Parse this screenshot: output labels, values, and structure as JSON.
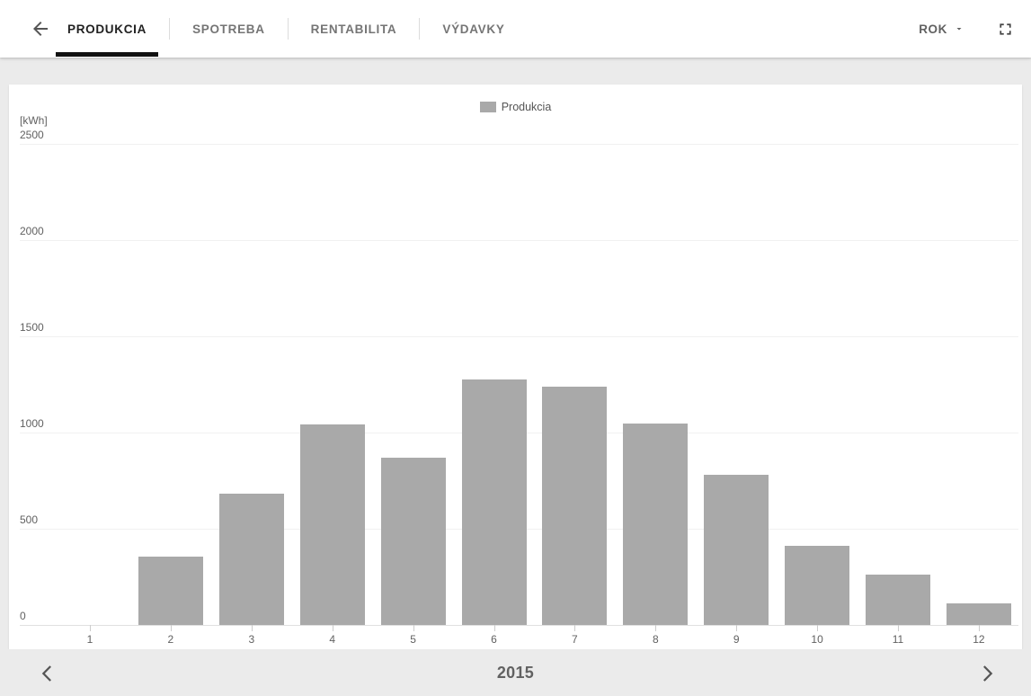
{
  "topbar": {
    "back_button": {
      "icon": "arrow-back"
    },
    "tabs": [
      {
        "label": "PRODUKCIA",
        "active": true
      },
      {
        "label": "SPOTREBA",
        "active": false
      },
      {
        "label": "RENTABILITA",
        "active": false
      },
      {
        "label": "VÝDAVKY",
        "active": false
      }
    ],
    "period_selector": {
      "label": "ROK",
      "icon": "caret-down"
    },
    "fullscreen_button": {
      "icon": "fullscreen-corners"
    }
  },
  "chart_data": {
    "type": "bar",
    "title": "",
    "unit_label": "[kWh]",
    "categories": [
      "1",
      "2",
      "3",
      "4",
      "5",
      "6",
      "7",
      "8",
      "9",
      "10",
      "11",
      "12"
    ],
    "series": [
      {
        "name": "Produkcia",
        "color": "#a9a9a9",
        "values": [
          0,
          355,
          680,
          1040,
          870,
          1275,
          1240,
          1045,
          780,
          410,
          260,
          110
        ]
      }
    ],
    "xlabel": "",
    "ylabel": "kWh",
    "ylim": [
      0,
      2500
    ],
    "yticks": [
      0,
      500,
      1000,
      1500,
      2000,
      2500
    ],
    "grid": true,
    "legend_position": "top"
  },
  "footer": {
    "year": "2015",
    "prev_icon": "chevron-left",
    "next_icon": "chevron-right"
  },
  "colors": {
    "bar": "#a9a9a9",
    "active_tab": "#212121",
    "inactive_tab": "#757575",
    "background": "#ebebeb",
    "card": "#ffffff",
    "axis_text": "#616161"
  }
}
